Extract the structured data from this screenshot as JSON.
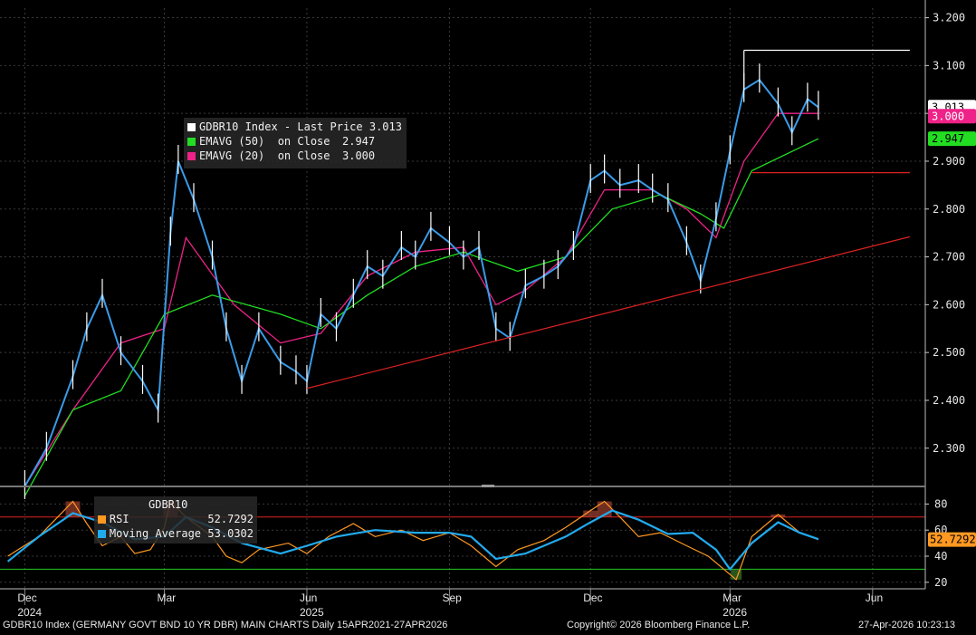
{
  "chart_data": [
    {
      "type": "line",
      "panel": "price",
      "ylim": [
        2.22,
        3.22
      ],
      "y_ticks": [
        "3.200",
        "3.100",
        "3.000",
        "2.900",
        "2.800",
        "2.700",
        "2.600",
        "2.500",
        "2.400",
        "2.300"
      ],
      "y_tick_values": [
        3.2,
        3.1,
        3.0,
        2.9,
        2.8,
        2.7,
        2.6,
        2.5,
        2.4,
        2.3
      ],
      "legend": {
        "rows": [
          {
            "label": "GDBR10 Index - Last Price",
            "value": "3.013",
            "color": "#ffffff"
          },
          {
            "label": "EMAVG (50)  on Close",
            "value": "2.947",
            "color": "#22dd22"
          },
          {
            "label": "EMAVG (20)  on Close",
            "value": "3.000",
            "color": "#ee2288"
          }
        ]
      },
      "price_labels": [
        {
          "value": "3.013",
          "y": 3.013,
          "bg": "#ffffff",
          "fg": "#000000"
        },
        {
          "value": "3.000",
          "y": 3.0,
          "bg": "#ee2288",
          "fg": "#ffffff"
        },
        {
          "value": "2.947",
          "y": 2.947,
          "bg": "#22dd22",
          "fg": "#000000"
        }
      ],
      "series": [
        {
          "name": "GDBR10 Index - Last Price",
          "color": "#3a9be8",
          "x": [
            "2024-12-01",
            "2024-12-15",
            "2025-01-01",
            "2025-01-10",
            "2025-01-20",
            "2025-02-01",
            "2025-02-15",
            "2025-02-25",
            "2025-03-05",
            "2025-03-10",
            "2025-03-20",
            "2025-04-01",
            "2025-04-10",
            "2025-04-20",
            "2025-05-01",
            "2025-05-15",
            "2025-05-25",
            "2025-06-01",
            "2025-06-10",
            "2025-06-20",
            "2025-07-01",
            "2025-07-10",
            "2025-07-20",
            "2025-08-01",
            "2025-08-10",
            "2025-08-20",
            "2025-09-01",
            "2025-09-10",
            "2025-09-20",
            "2025-10-01",
            "2025-10-10",
            "2025-10-20",
            "2025-11-01",
            "2025-11-10",
            "2025-11-20",
            "2025-12-01",
            "2025-12-10",
            "2025-12-20",
            "2026-01-01",
            "2026-01-10",
            "2026-01-20",
            "2026-02-01",
            "2026-02-10",
            "2026-02-20",
            "2026-03-01",
            "2026-03-10",
            "2026-03-20",
            "2026-04-01",
            "2026-04-10",
            "2026-04-20",
            "2026-04-27"
          ],
          "values": [
            2.22,
            2.3,
            2.45,
            2.55,
            2.62,
            2.5,
            2.44,
            2.38,
            2.75,
            2.9,
            2.82,
            2.7,
            2.55,
            2.44,
            2.55,
            2.48,
            2.46,
            2.44,
            2.58,
            2.55,
            2.62,
            2.68,
            2.66,
            2.72,
            2.7,
            2.76,
            2.73,
            2.7,
            2.72,
            2.55,
            2.53,
            2.64,
            2.66,
            2.68,
            2.72,
            2.86,
            2.88,
            2.85,
            2.86,
            2.84,
            2.82,
            2.73,
            2.65,
            2.78,
            2.92,
            3.05,
            3.07,
            3.02,
            2.96,
            3.03,
            3.013
          ]
        },
        {
          "name": "EMAVG (20)  on Close",
          "color": "#ee2288",
          "x": [
            "2024-12-01",
            "2025-01-01",
            "2025-02-01",
            "2025-03-01",
            "2025-03-15",
            "2025-04-15",
            "2025-05-15",
            "2025-06-10",
            "2025-07-10",
            "2025-08-10",
            "2025-09-10",
            "2025-10-01",
            "2025-10-20",
            "2025-11-15",
            "2025-12-10",
            "2026-01-10",
            "2026-02-01",
            "2026-02-20",
            "2026-03-10",
            "2026-04-01",
            "2026-04-27"
          ],
          "values": [
            2.22,
            2.38,
            2.52,
            2.55,
            2.74,
            2.6,
            2.52,
            2.54,
            2.66,
            2.71,
            2.72,
            2.6,
            2.63,
            2.7,
            2.84,
            2.84,
            2.8,
            2.74,
            2.9,
            3.0,
            3.0
          ]
        },
        {
          "name": "EMAVG (50)  on Close",
          "color": "#22dd22",
          "x": [
            "2024-12-01",
            "2025-01-01",
            "2025-02-01",
            "2025-03-01",
            "2025-04-01",
            "2025-05-15",
            "2025-06-10",
            "2025-07-10",
            "2025-08-10",
            "2025-09-10",
            "2025-10-15",
            "2025-11-15",
            "2025-12-15",
            "2026-01-15",
            "2026-02-10",
            "2026-02-25",
            "2026-03-15",
            "2026-04-27"
          ],
          "values": [
            2.2,
            2.38,
            2.42,
            2.58,
            2.62,
            2.58,
            2.55,
            2.62,
            2.68,
            2.71,
            2.67,
            2.7,
            2.8,
            2.83,
            2.79,
            2.76,
            2.88,
            2.947
          ]
        }
      ],
      "annotations": [
        {
          "type": "trendline",
          "color": "#dd2222",
          "from": {
            "x": "2025-06-01",
            "y": 2.425
          },
          "to": {
            "x": "2026-06-25",
            "y": 2.742
          }
        },
        {
          "type": "hline",
          "color": "#dd2222",
          "from_x": "2026-03-15",
          "to_x": "2026-06-25",
          "y": 2.876
        },
        {
          "type": "hline",
          "color": "#ffffff",
          "from_x": "2026-03-10",
          "to_x": "2026-06-25",
          "y": 3.132,
          "with_drop_to": 3.05
        }
      ]
    },
    {
      "type": "line",
      "panel": "rsi",
      "ylim": [
        15,
        90
      ],
      "y_ticks": [
        "80",
        "60",
        "40",
        "20"
      ],
      "y_tick_values": [
        80,
        60,
        40,
        20
      ],
      "bands": [
        {
          "y": 70,
          "color": "#dd2222"
        },
        {
          "y": 30,
          "color": "#22cc22"
        }
      ],
      "legend": {
        "title": "GDBR10",
        "rows": [
          {
            "label": "RSI",
            "value": "52.7292",
            "color": "#ff9922"
          },
          {
            "label": "Moving Average",
            "value": "53.0302",
            "color": "#22aaee"
          }
        ]
      },
      "value_label": {
        "value": "52.7292",
        "y": 52.7292,
        "bg": "#ff9922",
        "fg": "#000000"
      },
      "series": [
        {
          "name": "RSI",
          "color": "#ff9922",
          "x": [
            "2024-11-20",
            "2024-12-10",
            "2025-01-01",
            "2025-01-10",
            "2025-01-20",
            "2025-02-01",
            "2025-02-10",
            "2025-02-20",
            "2025-03-01",
            "2025-03-05",
            "2025-03-15",
            "2025-04-01",
            "2025-04-10",
            "2025-04-20",
            "2025-05-01",
            "2025-05-20",
            "2025-06-01",
            "2025-06-15",
            "2025-07-01",
            "2025-07-15",
            "2025-08-01",
            "2025-08-15",
            "2025-09-01",
            "2025-09-15",
            "2025-10-01",
            "2025-10-15",
            "2025-11-01",
            "2025-11-15",
            "2025-12-01",
            "2025-12-10",
            "2025-12-20",
            "2026-01-01",
            "2026-01-15",
            "2026-02-01",
            "2026-02-15",
            "2026-02-25",
            "2026-03-05",
            "2026-03-15",
            "2026-04-01",
            "2026-04-15",
            "2026-04-27"
          ],
          "values": [
            40,
            55,
            82,
            65,
            48,
            55,
            42,
            45,
            62,
            82,
            70,
            55,
            40,
            35,
            45,
            50,
            42,
            55,
            65,
            55,
            60,
            52,
            58,
            48,
            32,
            45,
            52,
            62,
            75,
            82,
            70,
            55,
            58,
            48,
            40,
            30,
            22,
            55,
            72,
            58,
            52.7292
          ]
        },
        {
          "name": "Moving Average",
          "color": "#22aaee",
          "x": [
            "2024-11-20",
            "2024-12-10",
            "2025-01-01",
            "2025-01-20",
            "2025-02-10",
            "2025-03-01",
            "2025-03-15",
            "2025-04-01",
            "2025-04-20",
            "2025-05-15",
            "2025-06-01",
            "2025-06-20",
            "2025-07-15",
            "2025-08-10",
            "2025-09-01",
            "2025-09-15",
            "2025-10-01",
            "2025-10-20",
            "2025-11-15",
            "2025-12-01",
            "2025-12-15",
            "2026-01-01",
            "2026-01-20",
            "2026-02-05",
            "2026-02-20",
            "2026-03-01",
            "2026-03-15",
            "2026-04-01",
            "2026-04-15",
            "2026-04-27"
          ],
          "values": [
            36,
            55,
            73,
            66,
            53,
            55,
            70,
            62,
            50,
            42,
            48,
            55,
            60,
            58,
            58,
            55,
            38,
            42,
            55,
            66,
            75,
            68,
            57,
            58,
            45,
            30,
            50,
            66,
            58,
            53.0302
          ]
        }
      ]
    }
  ],
  "x_axis": {
    "start": "2024-11-15",
    "end": "2026-07-05",
    "ticks": [
      {
        "date": "2024-12-01",
        "label": "Dec",
        "year": "2024"
      },
      {
        "date": "2025-03-01",
        "label": "Mar"
      },
      {
        "date": "2025-06-01",
        "label": "Jun",
        "year": "2025"
      },
      {
        "date": "2025-09-01",
        "label": "Sep"
      },
      {
        "date": "2025-12-01",
        "label": "Dec"
      },
      {
        "date": "2026-03-01",
        "label": "Mar",
        "year": "2026"
      },
      {
        "date": "2026-06-01",
        "label": "Jun"
      }
    ]
  },
  "footer": {
    "left": "GDBR10 Index (GERMANY GOVT BND 10 YR DBR) MAIN CHARTS Daily 15APR2021-27APR2026",
    "center": "Copyright© 2026 Bloomberg Finance L.P.",
    "right": "27-Apr-2026 10:23:13"
  },
  "colors": {
    "background": "#000000",
    "grid": "#3a3a3a",
    "axis_text": "#e6e6e6"
  }
}
